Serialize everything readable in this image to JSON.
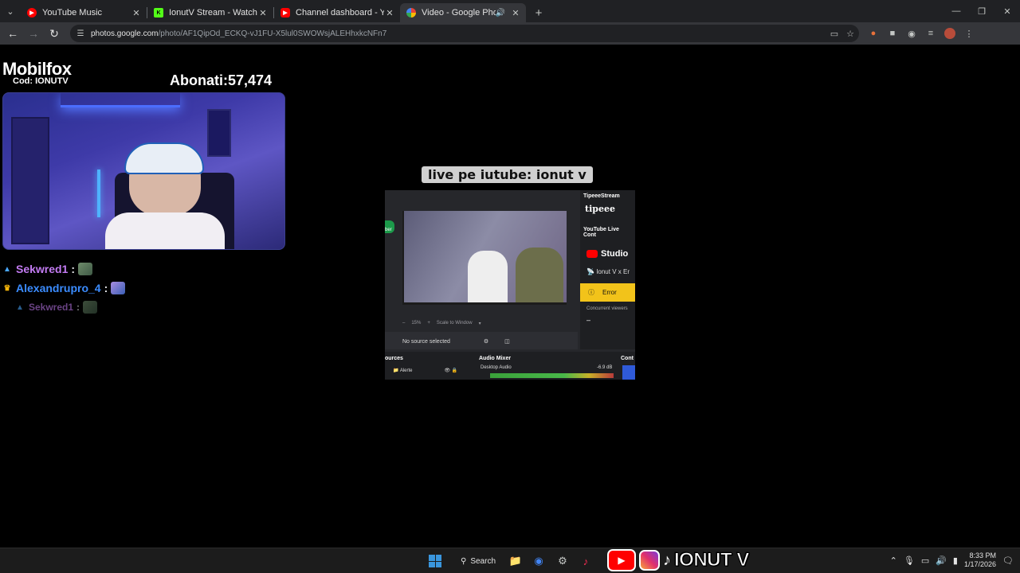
{
  "browser": {
    "tabs": [
      {
        "title": "YouTube Music",
        "favicon": "youtube-music-icon",
        "color": "#ff0000",
        "active": false
      },
      {
        "title": "IonutV Stream - Watch Live on",
        "favicon": "kick-icon",
        "color": "#53fc18",
        "active": false
      },
      {
        "title": "Channel dashboard - YouTube",
        "favicon": "youtube-icon",
        "color": "#ff0000",
        "active": false
      },
      {
        "title": "Video - Google Photos",
        "favicon": "google-photos-icon",
        "color": "#fbbc04",
        "active": true
      }
    ],
    "url_host": "photos.google.com",
    "url_path": "/photo/AF1QipOd_ECKQ-vJ1FU-X5lul0SWOWsjALEHhxkcNFn7"
  },
  "overlay": {
    "brand_name": "Mobilfox",
    "code_label": "Cod: IONUTV",
    "subscribers_label": "Abonati:",
    "subscribers_count": "57,474",
    "caption": "live pe iutube: ionut v"
  },
  "chat": [
    {
      "user": "Sekwred1",
      "sep": ":",
      "color": "#c27bf2",
      "badge": "▲",
      "badge_color": "#4aa8ff"
    },
    {
      "user": "Alexandrupro_4",
      "sep": ":",
      "color": "#3b8cff",
      "badge": "♛",
      "badge_color": "#f5b50a"
    },
    {
      "user": "Sekwred1",
      "sep": ":",
      "color": "#c27bf2",
      "badge": "▲",
      "badge_color": "#4aa8ff"
    }
  ],
  "obs": {
    "preview_chat_text": "",
    "zoom_text": "15%",
    "scale_text": "Scale to Window",
    "no_source": "No source selected",
    "tipee_title": "TipeeeStream",
    "tipee_logo": "tipeee",
    "yt_live_title": "YouTube Live Cont",
    "studio_label": "Studio",
    "live_title": "Ionut V x Er",
    "error_label": "Error",
    "concurrent_label": "Concurrent viewers",
    "concurrent_value": "–",
    "sources_title": "ources",
    "source_item": "Alerte",
    "audio_title": "Audio Mixer",
    "audio_item": "Desktop Audio",
    "audio_db": "-6.9 dB",
    "controls_title": "Cont",
    "left_tab": "ber"
  },
  "taskbar": {
    "search_label": "Search",
    "brand_name": "IONUT V",
    "time": "8:33 PM",
    "date": "1/17/2026"
  }
}
